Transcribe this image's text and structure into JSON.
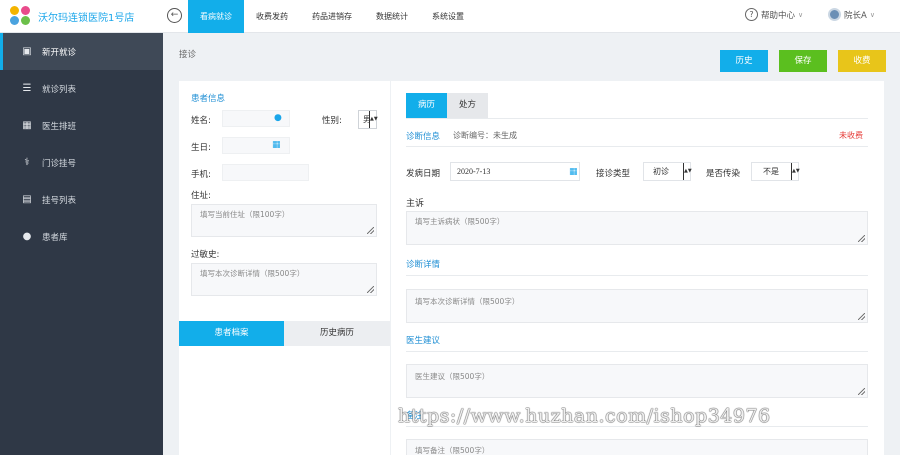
{
  "app": {
    "brand": "沃尔玛连锁医院1号店"
  },
  "nav": {
    "items": [
      {
        "label": "看病就诊",
        "active": true
      },
      {
        "label": "收费发药"
      },
      {
        "label": "药品进销存"
      },
      {
        "label": "数据统计"
      },
      {
        "label": "系统设置"
      }
    ],
    "help": "帮助中心",
    "user": "院长A"
  },
  "sidebar": {
    "items": [
      {
        "label": "新开就诊",
        "icon": "briefcase-icon",
        "active": true
      },
      {
        "label": "就诊列表",
        "icon": "list-icon"
      },
      {
        "label": "医生排班",
        "icon": "calendar-icon"
      },
      {
        "label": "门诊挂号",
        "icon": "stethoscope-icon"
      },
      {
        "label": "挂号列表",
        "icon": "table-icon"
      },
      {
        "label": "患者库",
        "icon": "user-icon"
      }
    ]
  },
  "main": {
    "breadcrumb": "接诊",
    "buttons": {
      "history": "历史",
      "save": "保存",
      "charge": "收费"
    }
  },
  "patient": {
    "title": "患者信息",
    "name_label": "姓名:",
    "gender_label": "性别:",
    "gender_value": "男",
    "birthday_label": "生日:",
    "phone_label": "手机:",
    "address_label": "住址:",
    "address_placeholder": "填写当前住址（限100字）",
    "allergy_label": "过敏史:",
    "allergy_placeholder": "填写本次诊断详情（限500字）",
    "tabs": [
      "患者档案",
      "历史病历"
    ]
  },
  "record": {
    "tabs": [
      "病历",
      "处方"
    ],
    "diag_info": "诊断信息",
    "diag_no": "诊断编号：未生成",
    "status": "未收费",
    "onset_label": "发病日期",
    "onset_value": "2020-7-13",
    "type_label": "接诊类型",
    "type_value": "初诊",
    "infect_label": "是否传染",
    "infect_value": "不是",
    "complaint_label": "主诉",
    "complaint_placeholder": "填写主诉病状（限500字）",
    "detail_label": "诊断详情",
    "detail_placeholder": "填写本次诊断详情（限500字）",
    "advice_label": "医生建议",
    "advice_placeholder": "医生建议（限500字）",
    "remark_label": "备注",
    "remark_placeholder": "填写备注（限500字）"
  },
  "watermark": "https://www.huzhan.com/ishop34976",
  "colors": {
    "accent": "#12aeea",
    "sidebar": "#2f3846",
    "save": "#5bbf1f",
    "charge": "#e8c51a",
    "status": "#e53935"
  }
}
